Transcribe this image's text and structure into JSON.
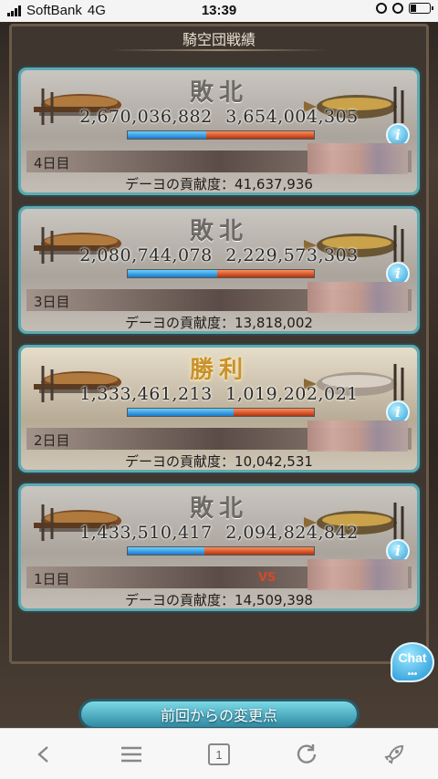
{
  "status_bar": {
    "carrier": "SoftBank",
    "network": "4G",
    "time": "13:39",
    "battery_level": 0.3
  },
  "screen_title": "騎空団戦績",
  "battles": [
    {
      "result": "敗北",
      "won": false,
      "score_left": "2,670,036,882",
      "score_right": "3,654,004,305",
      "left_ratio": 0.42,
      "day": "4日目",
      "contribution": "デーヨの貢献度：41,637,936"
    },
    {
      "result": "敗北",
      "won": false,
      "score_left": "2,080,744,078",
      "score_right": "2,229,573,303",
      "left_ratio": 0.48,
      "day": "3日目",
      "contribution": "デーヨの貢献度：13,818,002"
    },
    {
      "result": "勝利",
      "won": true,
      "score_left": "1,333,461,213",
      "score_right": "1,019,202,021",
      "left_ratio": 0.57,
      "day": "2日目",
      "contribution": "デーヨの貢献度：10,042,531"
    },
    {
      "result": "敗北",
      "won": false,
      "score_left": "1,433,510,417",
      "score_right": "2,094,824,842",
      "left_ratio": 0.41,
      "day": "1日目",
      "vs_label": "VS",
      "contribution": "デーヨの貢献度：14,509,398"
    }
  ],
  "info_label": "i",
  "chat_label": "Chat",
  "chat_dots": "•••",
  "change_button": "前回からの変更点",
  "browser_toolbar": {
    "tabs_count": "1",
    "icons": [
      "back-icon",
      "menu-icon",
      "tabs-icon",
      "reload-icon",
      "rocket-icon"
    ]
  },
  "colors": {
    "card_border": "#5fa9b0",
    "our_bar": "#1c79c9",
    "enemy_bar": "#b23310",
    "win_text": "#c9912e"
  }
}
